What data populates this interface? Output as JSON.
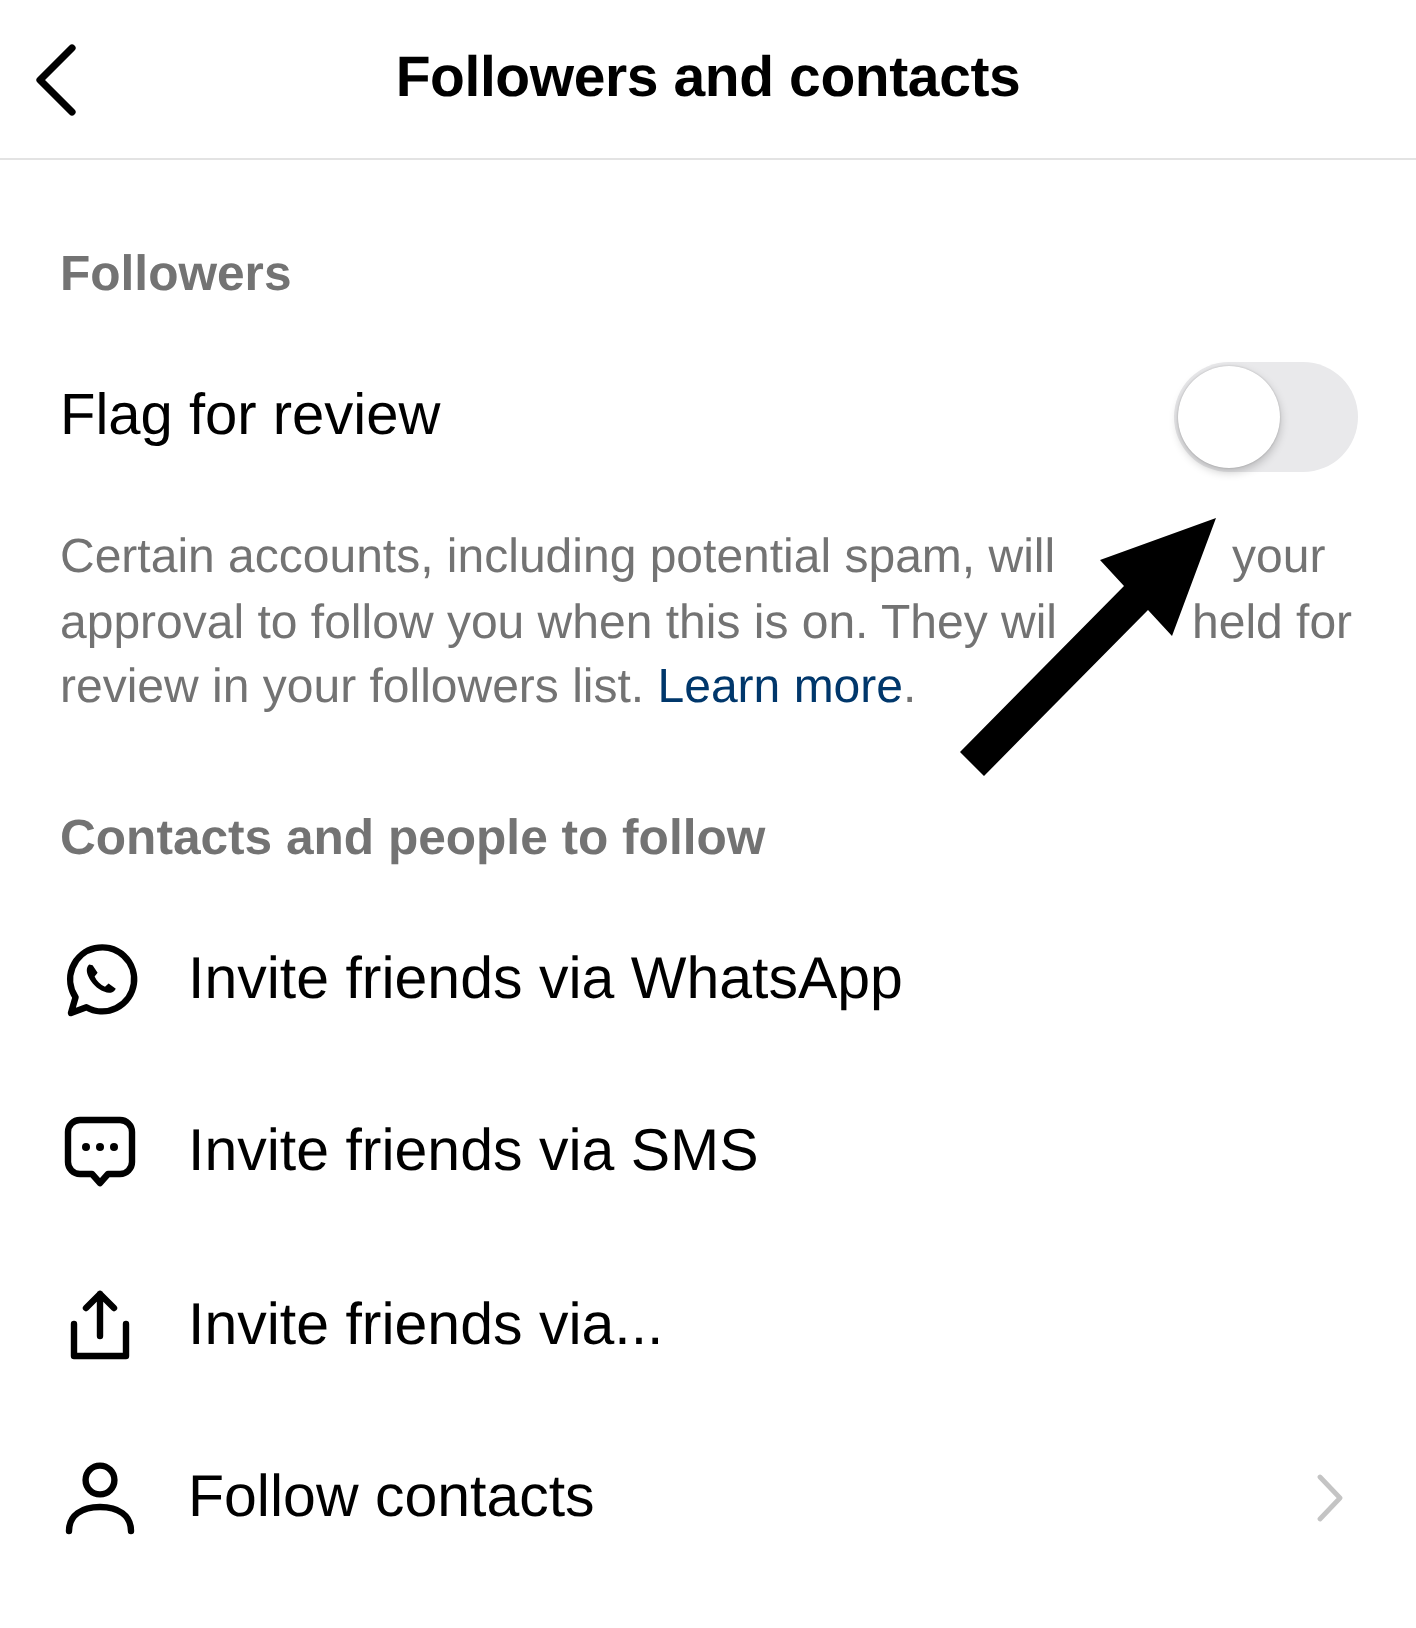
{
  "header": {
    "title": "Followers and contacts"
  },
  "followers": {
    "heading": "Followers",
    "toggle": {
      "label": "Flag for review",
      "on": false
    },
    "description": {
      "lines": [
        {
          "parts": [
            "Certain accounts, including potential spam, will",
            "your"
          ]
        },
        {
          "parts": [
            "approval to follow you when this is on. They wil",
            "held for"
          ]
        },
        {
          "parts": [
            "review in your followers list. "
          ],
          "link": "Learn more",
          "end": "."
        }
      ]
    }
  },
  "contacts": {
    "heading": "Contacts and people to follow",
    "items": [
      {
        "kind": "chat",
        "label": "Invite friends via WhatsApp",
        "chevron": false
      },
      {
        "kind": "message",
        "label": "Invite friends via SMS",
        "chevron": false
      },
      {
        "kind": "share",
        "label": "Invite friends via...",
        "chevron": false
      },
      {
        "kind": "person",
        "label": "Follow contacts",
        "chevron": true
      }
    ]
  }
}
